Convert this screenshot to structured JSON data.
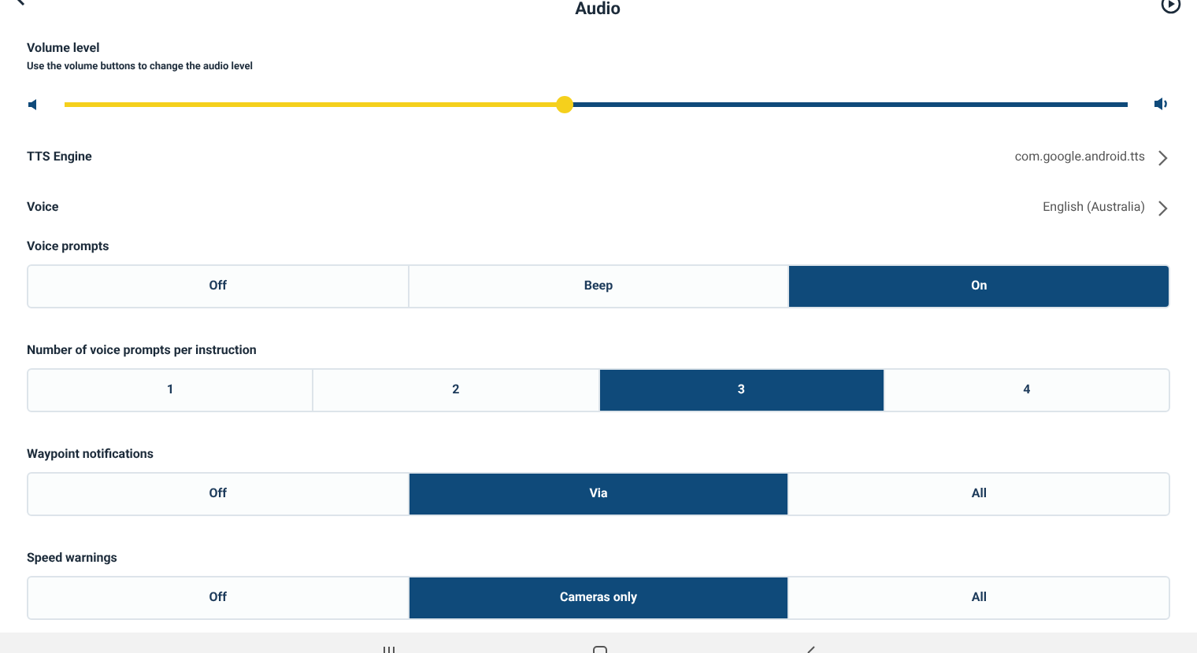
{
  "header": {
    "title": "Audio"
  },
  "volume": {
    "label": "Volume level",
    "hint": "Use the volume buttons to change the audio level",
    "level": 0.47
  },
  "links": [
    {
      "label": "TTS Engine",
      "value": "com.google.android.tts"
    },
    {
      "label": "Voice",
      "value": "English (Australia)"
    }
  ],
  "groups": [
    {
      "label": "Voice prompts",
      "options": [
        {
          "label": "Off",
          "selected": false
        },
        {
          "label": "Beep",
          "selected": false
        },
        {
          "label": "On",
          "selected": true
        }
      ]
    },
    {
      "label": "Number of voice prompts per instruction",
      "options": [
        {
          "label": "1",
          "selected": false
        },
        {
          "label": "2",
          "selected": false
        },
        {
          "label": "3",
          "selected": true
        },
        {
          "label": "4",
          "selected": false
        }
      ]
    },
    {
      "label": "Waypoint notifications",
      "options": [
        {
          "label": "Off",
          "selected": false
        },
        {
          "label": "Via",
          "selected": true
        },
        {
          "label": "All",
          "selected": false
        }
      ]
    },
    {
      "label": "Speed warnings",
      "options": [
        {
          "label": "Off",
          "selected": false
        },
        {
          "label": "Cameras only",
          "selected": true
        },
        {
          "label": "All",
          "selected": false
        }
      ]
    }
  ]
}
